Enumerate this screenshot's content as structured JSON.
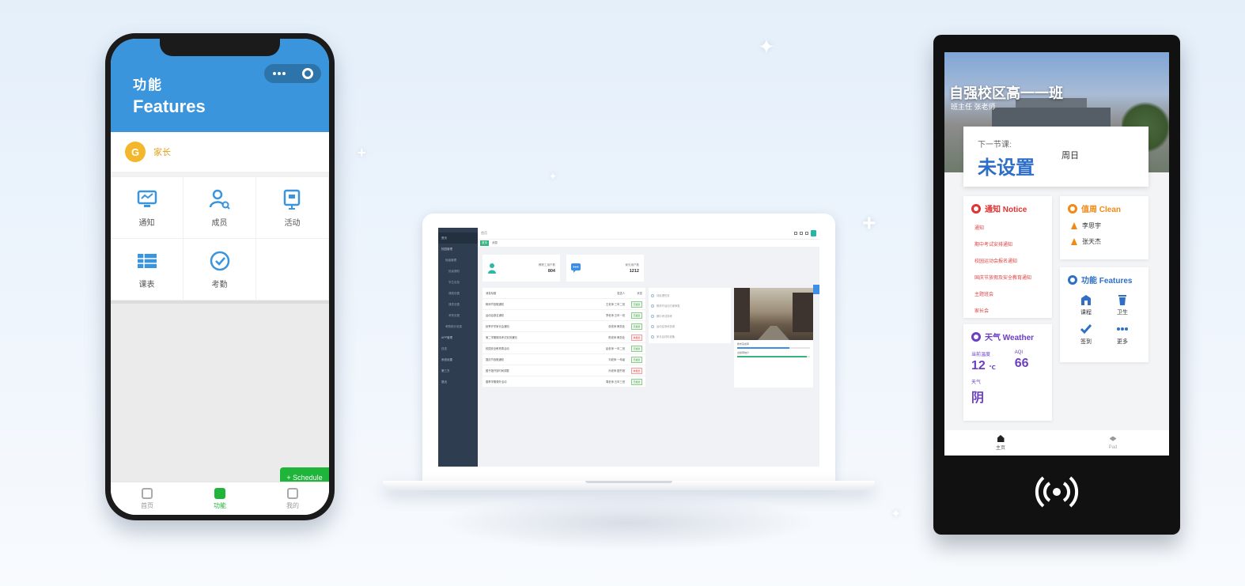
{
  "phone": {
    "header_sub": "功能",
    "header_title": "Features",
    "username": "家长",
    "tiles": [
      {
        "label": "通知",
        "icon": "monitor-icon"
      },
      {
        "label": "成员",
        "icon": "user-search-icon"
      },
      {
        "label": "活动",
        "icon": "board-icon"
      },
      {
        "label": "课表",
        "icon": "table-icon"
      },
      {
        "label": "考勤",
        "icon": "check-circle-icon"
      }
    ],
    "floating_button": "+ Schedule",
    "tabs": [
      {
        "label": "首页"
      },
      {
        "label": "功能"
      },
      {
        "label": "我的"
      }
    ],
    "accent": "#3a95dc",
    "active_color": "#1fb43a"
  },
  "laptop": {
    "top_path": "首页",
    "tags": [
      "首页",
      "消息"
    ],
    "sidebar": [
      "首页",
      "校园管理",
      "班级管理",
      "班级通知",
      "学生信息",
      "课程设置",
      "课表设置",
      "考勤设置",
      "考勤统计信息",
      "APP管理",
      "日志",
      "系统设置",
      "第三方",
      "退出"
    ],
    "stats": [
      {
        "label": "教职工用户数",
        "value": "804"
      },
      {
        "label": "家长用户数",
        "value": "1212"
      }
    ],
    "table_header": [
      "消息标题",
      "发送人",
      "状态"
    ],
    "rows": [
      {
        "title": "教师节放假通知",
        "sender": "王老师 三年二班",
        "status": "已发送",
        "ok": true
      },
      {
        "title": "运动会报名通知",
        "sender": "李老师 五年一班",
        "status": "已发送",
        "ok": true
      },
      {
        "title": "秋季开学家长会通知",
        "sender": "张老师 教务处",
        "status": "已发送",
        "ok": true
      },
      {
        "title": "第二学期期末考试安排通知",
        "sender": "陈老师 教务处",
        "status": "未发送",
        "ok": false
      },
      {
        "title": "校园安全教育周活动",
        "sender": "赵老师 一年二班",
        "status": "已发送",
        "ok": true
      },
      {
        "title": "国庆节放假通知",
        "sender": "刘老师 一年级",
        "status": "已发送",
        "ok": true
      },
      {
        "title": "图书馆开放时间调整",
        "sender": "孙老师 图书馆",
        "status": "未发送",
        "ok": false
      },
      {
        "title": "春季学期课外活动",
        "sender": "周老师 五年三班",
        "status": "已发送",
        "ok": true
      }
    ],
    "steps": [
      "待处理任务",
      "教师节活动方案审批",
      "期中考试排考",
      "运动会场地协调",
      "家长会材料准备"
    ],
    "photo_bars": [
      {
        "label": "教学完成率",
        "value": 0.72
      },
      {
        "label": "出勤率统计",
        "value": 0.96
      }
    ]
  },
  "kiosk": {
    "class_title": "自强校区高一一班",
    "class_sub": "班主任 张老师",
    "next_label": "下一节课:",
    "next_value": "未设置",
    "next_date": "周日",
    "notice_title": "通知 Notice",
    "notices": [
      "通知",
      "期中考试安排通知",
      "校园运动会报名通知",
      "国庆节放假及安全教育通知",
      "主题班会",
      "家长会"
    ],
    "clean_title": "值周 Clean",
    "cleaners": [
      "李思宇",
      "张天杰"
    ],
    "features_title": "功能 Features",
    "features": [
      {
        "label": "课程",
        "icon": "building-icon"
      },
      {
        "label": "卫生",
        "icon": "trash-icon"
      },
      {
        "label": "签到",
        "icon": "check-icon"
      },
      {
        "label": "更多",
        "icon": "more-icon"
      }
    ],
    "weather_title": "天气 Weather",
    "weather_temp_label": "当前温度",
    "weather_temp": "12",
    "weather_temp_unit": "℃",
    "weather_aqi_label": "AQI",
    "weather_aqi": "66",
    "weather_cond_label": "天气",
    "weather_cond": "阴",
    "tabs": [
      "主页",
      "Pad"
    ]
  }
}
